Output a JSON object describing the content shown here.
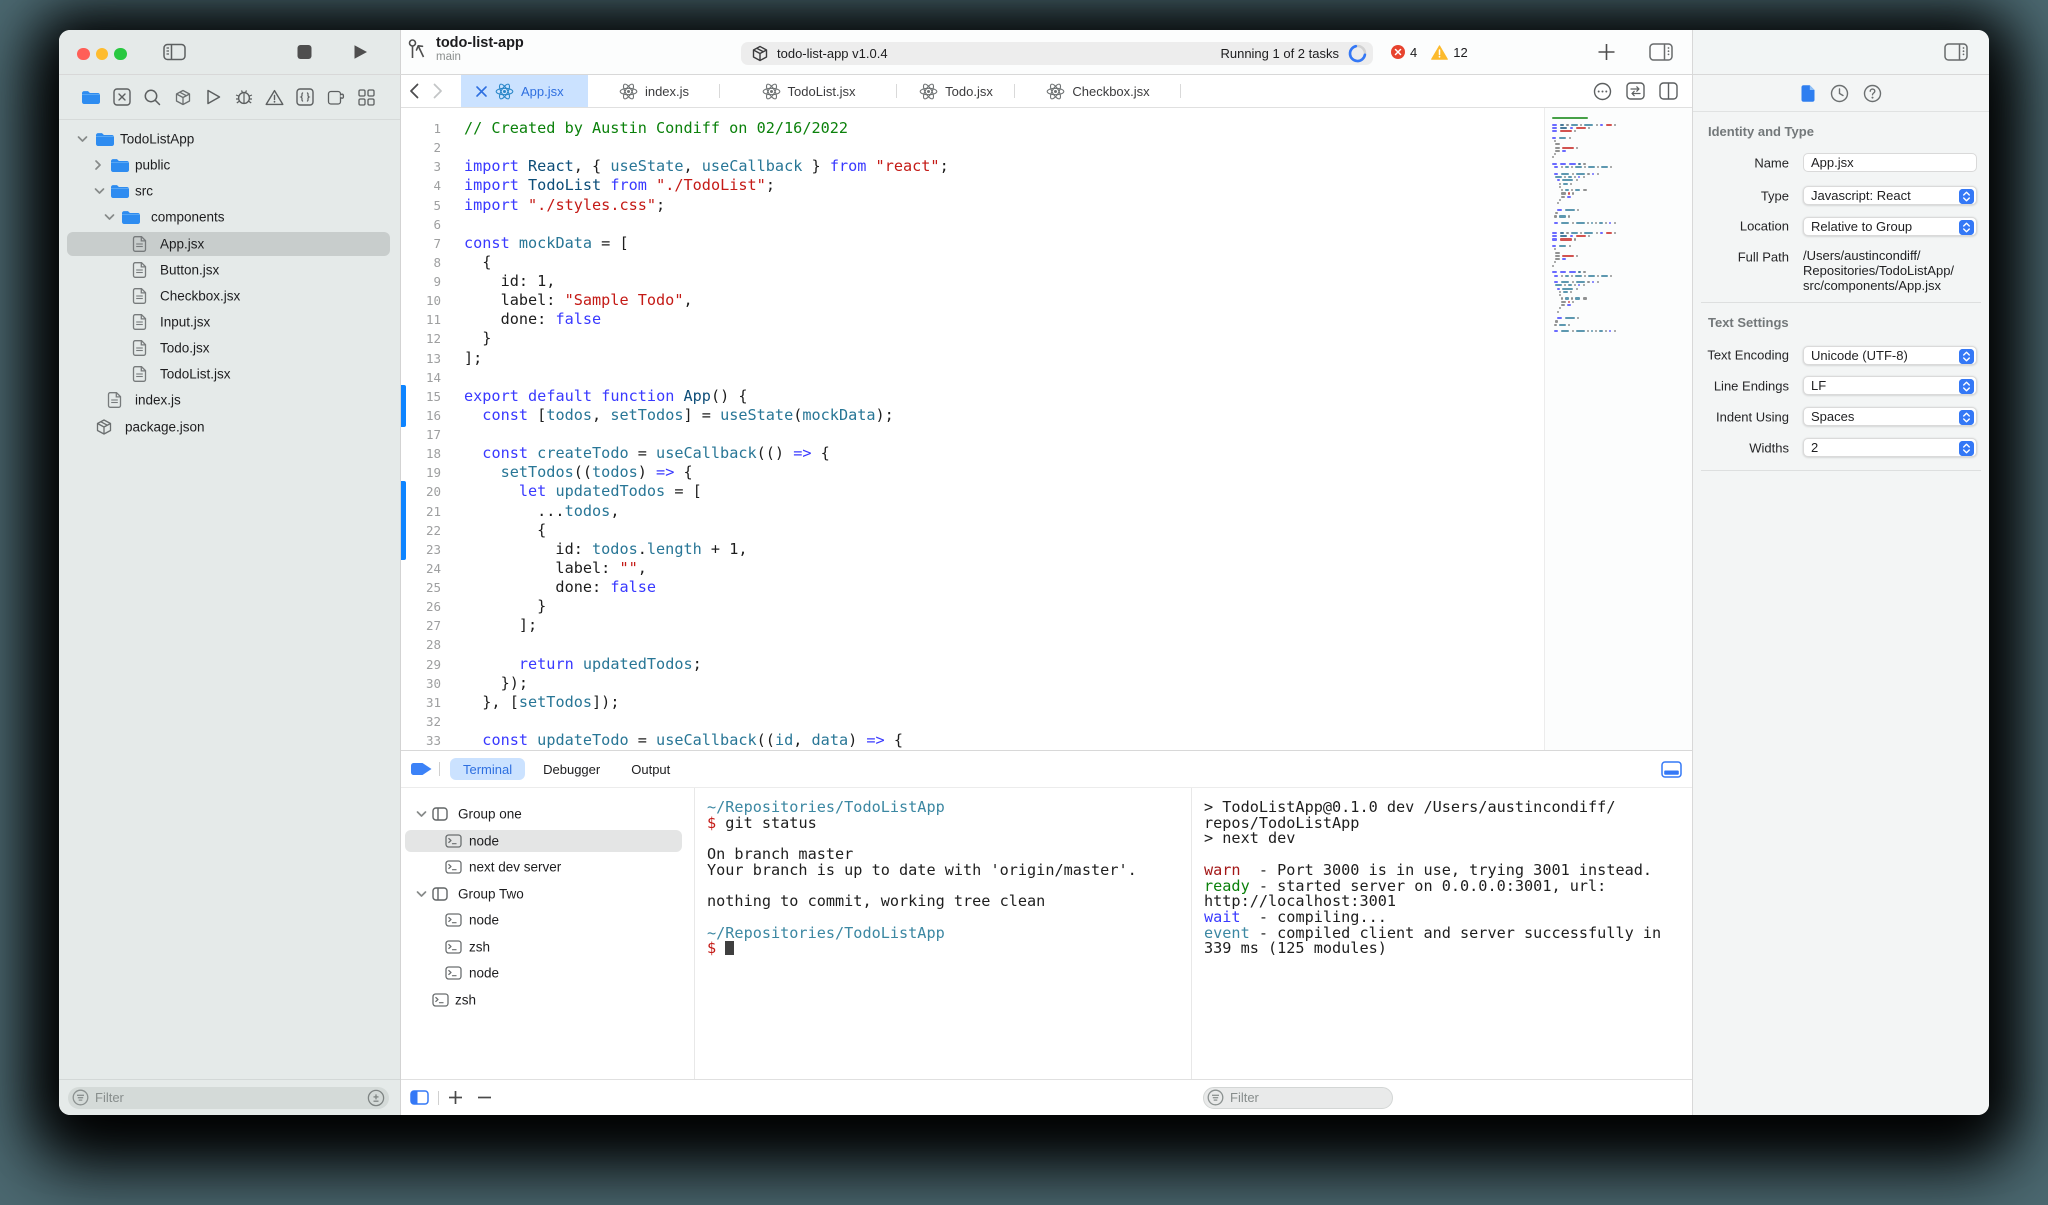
{
  "colors": {
    "accent": "#3478f6",
    "active_tab_bg": "#cbe2ff",
    "change_bar": "#0e84ff",
    "code": {
      "keyword": "#3939ff",
      "type": "#0c4d78",
      "identifier": "#287696",
      "string": "#c41a16",
      "comment": "#0b810b",
      "plain": "#1d1d1d"
    },
    "terminal": {
      "path": "#3b87a2",
      "dollar": "#c41a16",
      "warn": "#a31616",
      "ready": "#0b810b",
      "wait": "#3939ff",
      "event": "#3b87a2"
    }
  },
  "titlebar": {
    "project_name": "todo-list-app",
    "branch": "main",
    "window_controls": [
      "close",
      "minimize",
      "zoom"
    ],
    "left_icons": [
      "sidebar-toggle",
      "stop",
      "run"
    ],
    "status_pill": {
      "app_icon": "package-icon",
      "app_label": "todo-list-app v1.0.4",
      "task_status": "Running 1 of 2 tasks",
      "spinner": "progress-spinner"
    },
    "error_count": "4",
    "warning_count": "12",
    "right_icons": [
      "add",
      "panel-right-toggle"
    ],
    "inspector_icon": "panel-right-toggle"
  },
  "navigator": {
    "toolbar_icons": [
      "project-navigator",
      "xmark-square",
      "search",
      "package",
      "play-outline",
      "bug",
      "warning-triangle",
      "braces-square",
      "extension",
      "grid"
    ],
    "tree": [
      {
        "label": "TodoListApp",
        "icon": "folder",
        "chevron": "down"
      },
      {
        "label": "public",
        "icon": "folder",
        "chevron": "right"
      },
      {
        "label": "src",
        "icon": "folder",
        "chevron": "down"
      },
      {
        "label": "components",
        "icon": "folder",
        "chevron": "down"
      },
      {
        "label": "App.jsx",
        "icon": "file",
        "selected": true
      },
      {
        "label": "Button.jsx",
        "icon": "file"
      },
      {
        "label": "Checkbox.jsx",
        "icon": "file"
      },
      {
        "label": "Input.jsx",
        "icon": "file"
      },
      {
        "label": "Todo.jsx",
        "icon": "file"
      },
      {
        "label": "TodoList.jsx",
        "icon": "file"
      },
      {
        "label": "index.js",
        "icon": "file"
      },
      {
        "label": "package.json",
        "icon": "package"
      }
    ],
    "filter": {
      "placeholder": "Filter",
      "left_icon": "filter-icon",
      "right_icon": "add-filter-icon"
    }
  },
  "tabs": [
    {
      "label": "App.jsx",
      "icon": "react",
      "active": true,
      "closable": true
    },
    {
      "label": "index.js",
      "icon": "react"
    },
    {
      "label": "TodoList.jsx",
      "icon": "react"
    },
    {
      "label": "Todo.jsx",
      "icon": "react"
    },
    {
      "label": "Checkbox.jsx",
      "icon": "react"
    }
  ],
  "tabbar_right_icons": [
    "ellipsis-circle",
    "swap",
    "split-editor"
  ],
  "editor": {
    "language": "jsx",
    "change_bars": [
      {
        "from_line": 15,
        "to_line": 16
      },
      {
        "from_line": 20,
        "to_line": 23
      }
    ],
    "lines": [
      [
        [
          "c",
          "// Created by Austin Condiff on 02/16/2022"
        ]
      ],
      [],
      [
        [
          "k",
          "import"
        ],
        [
          "p",
          " "
        ],
        [
          "t",
          "React"
        ],
        [
          "p",
          ", { "
        ],
        [
          "f",
          "useState"
        ],
        [
          "p",
          ", "
        ],
        [
          "f",
          "useCallback"
        ],
        [
          "p",
          " } "
        ],
        [
          "k",
          "from"
        ],
        [
          "p",
          " "
        ],
        [
          "s",
          "\"react\""
        ],
        [
          "p",
          ";"
        ]
      ],
      [
        [
          "k",
          "import"
        ],
        [
          "p",
          " "
        ],
        [
          "t",
          "TodoList"
        ],
        [
          "p",
          " "
        ],
        [
          "k",
          "from"
        ],
        [
          "p",
          " "
        ],
        [
          "s",
          "\"./TodoList\""
        ],
        [
          "p",
          ";"
        ]
      ],
      [
        [
          "k",
          "import"
        ],
        [
          "p",
          " "
        ],
        [
          "s",
          "\"./styles.css\""
        ],
        [
          "p",
          ";"
        ]
      ],
      [],
      [
        [
          "k",
          "const"
        ],
        [
          "p",
          " "
        ],
        [
          "f",
          "mockData"
        ],
        [
          "p",
          " = ["
        ]
      ],
      [
        [
          "p",
          "  {"
        ]
      ],
      [
        [
          "p",
          "    id: 1,"
        ]
      ],
      [
        [
          "p",
          "    label: "
        ],
        [
          "s",
          "\"Sample Todo\""
        ],
        [
          "p",
          ","
        ]
      ],
      [
        [
          "p",
          "    done: "
        ],
        [
          "k",
          "false"
        ]
      ],
      [
        [
          "p",
          "  }"
        ]
      ],
      [
        [
          "p",
          "];"
        ]
      ],
      [],
      [
        [
          "k",
          "export"
        ],
        [
          "p",
          " "
        ],
        [
          "k",
          "default"
        ],
        [
          "p",
          " "
        ],
        [
          "k",
          "function"
        ],
        [
          "p",
          " "
        ],
        [
          "t",
          "App"
        ],
        [
          "p",
          "() {"
        ]
      ],
      [
        [
          "p",
          "  "
        ],
        [
          "k",
          "const"
        ],
        [
          "p",
          " ["
        ],
        [
          "f",
          "todos"
        ],
        [
          "p",
          ", "
        ],
        [
          "f",
          "setTodos"
        ],
        [
          "p",
          "] = "
        ],
        [
          "f",
          "useState"
        ],
        [
          "p",
          "("
        ],
        [
          "f",
          "mockData"
        ],
        [
          "p",
          ");"
        ]
      ],
      [],
      [
        [
          "p",
          "  "
        ],
        [
          "k",
          "const"
        ],
        [
          "p",
          " "
        ],
        [
          "f",
          "createTodo"
        ],
        [
          "p",
          " = "
        ],
        [
          "f",
          "useCallback"
        ],
        [
          "p",
          "(() "
        ],
        [
          "k",
          "=>"
        ],
        [
          "p",
          " {"
        ]
      ],
      [
        [
          "p",
          "    "
        ],
        [
          "f",
          "setTodos"
        ],
        [
          "p",
          "(("
        ],
        [
          "f",
          "todos"
        ],
        [
          "p",
          ") "
        ],
        [
          "k",
          "=>"
        ],
        [
          "p",
          " {"
        ]
      ],
      [
        [
          "p",
          "      "
        ],
        [
          "k",
          "let"
        ],
        [
          "p",
          " "
        ],
        [
          "f",
          "updatedTodos"
        ],
        [
          "p",
          " = ["
        ]
      ],
      [
        [
          "p",
          "        ..."
        ],
        [
          "f",
          "todos"
        ],
        [
          "p",
          ","
        ]
      ],
      [
        [
          "p",
          "        {"
        ]
      ],
      [
        [
          "p",
          "          id: "
        ],
        [
          "f",
          "todos"
        ],
        [
          "p",
          "."
        ],
        [
          "f",
          "length"
        ],
        [
          "p",
          " + 1,"
        ]
      ],
      [
        [
          "p",
          "          label: "
        ],
        [
          "s",
          "\"\""
        ],
        [
          "p",
          ","
        ]
      ],
      [
        [
          "p",
          "          done: "
        ],
        [
          "k",
          "false"
        ]
      ],
      [
        [
          "p",
          "        }"
        ]
      ],
      [
        [
          "p",
          "      ];"
        ]
      ],
      [],
      [
        [
          "p",
          "      "
        ],
        [
          "k",
          "return"
        ],
        [
          "p",
          " "
        ],
        [
          "f",
          "updatedTodos"
        ],
        [
          "p",
          ";"
        ]
      ],
      [
        [
          "p",
          "    });"
        ]
      ],
      [
        [
          "p",
          "  }, ["
        ],
        [
          "f",
          "setTodos"
        ],
        [
          "p",
          "]);"
        ]
      ],
      [],
      [
        [
          "p",
          "  "
        ],
        [
          "k",
          "const"
        ],
        [
          "p",
          " "
        ],
        [
          "f",
          "updateTodo"
        ],
        [
          "p",
          " = "
        ],
        [
          "f",
          "useCallback"
        ],
        [
          "p",
          "(("
        ],
        [
          "f",
          "id"
        ],
        [
          "p",
          ", "
        ],
        [
          "f",
          "data"
        ],
        [
          "p",
          ") "
        ],
        [
          "k",
          "=>"
        ],
        [
          "p",
          " {"
        ]
      ]
    ]
  },
  "bottom_panel": {
    "tabs": [
      {
        "label": "Terminal",
        "active": true
      },
      {
        "label": "Debugger"
      },
      {
        "label": "Output"
      }
    ],
    "leading_icon": "tag-blue",
    "collapse_icon": "collapse-bottom",
    "groups": [
      {
        "label": "Group one",
        "kind": "group"
      },
      {
        "label": "node",
        "kind": "item",
        "selected": true
      },
      {
        "label": "next dev server",
        "kind": "item"
      },
      {
        "label": "Group Two",
        "kind": "group"
      },
      {
        "label": "node",
        "kind": "item"
      },
      {
        "label": "zsh",
        "kind": "item"
      },
      {
        "label": "node",
        "kind": "item"
      },
      {
        "label": "zsh",
        "kind": "loose"
      }
    ],
    "terminal1": [
      [
        [
          "path",
          "~/Repositories/TodoListApp"
        ]
      ],
      [
        [
          "dollar",
          "$ "
        ],
        [
          "p",
          "git status"
        ]
      ],
      [],
      [
        [
          "p",
          "On branch master"
        ]
      ],
      [
        [
          "p",
          "Your branch is up to date with 'origin/master'."
        ]
      ],
      [],
      [
        [
          "p",
          "nothing to commit, working tree clean"
        ]
      ],
      [],
      [
        [
          "path",
          "~/Repositories/TodoListApp"
        ]
      ],
      [
        [
          "dollar",
          "$ "
        ],
        [
          "cursor",
          ""
        ]
      ]
    ],
    "terminal2": [
      [
        [
          "p",
          "> TodoListApp@0.1.0 dev /Users/austincondiff/"
        ]
      ],
      [
        [
          "p",
          "repos/TodoListApp"
        ]
      ],
      [
        [
          "p",
          "> next dev"
        ]
      ],
      [],
      [
        [
          "warn",
          "warn"
        ],
        [
          "p",
          "  - Port 3000 is in use, trying 3001 instead."
        ]
      ],
      [
        [
          "ready",
          "ready"
        ],
        [
          "p",
          " - started server on 0.0.0.0:3001, url:"
        ]
      ],
      [
        [
          "p",
          "http://localhost:3001"
        ]
      ],
      [
        [
          "wait",
          "wait"
        ],
        [
          "p",
          "  - compiling..."
        ]
      ],
      [
        [
          "event",
          "event"
        ],
        [
          "p",
          " - compiled client and server successfully in"
        ]
      ],
      [
        [
          "p",
          "339 ms (125 modules)"
        ]
      ]
    ],
    "bottom_icons": [
      "sidebar-blue",
      "plus",
      "minus"
    ],
    "filter": {
      "placeholder": "Filter",
      "left_icon": "filter-icon"
    }
  },
  "inspector": {
    "tab_icons": [
      "file-inspector",
      "history-inspector",
      "help-inspector"
    ],
    "sections": [
      {
        "header": "Identity and Type",
        "rows": [
          {
            "label": "Name",
            "kind": "input",
            "value": "App.jsx"
          },
          {
            "label": "Type",
            "kind": "popup",
            "value": "Javascript: React"
          },
          {
            "label": "Location",
            "kind": "popup",
            "value": "Relative to Group"
          },
          {
            "label": "Full Path",
            "kind": "text",
            "value": "/Users/austincondiff/\nRepositories/TodoListApp/\nsrc/components/App.jsx"
          }
        ]
      },
      {
        "header": "Text Settings",
        "rows": [
          {
            "label": "Text Encoding",
            "kind": "popup",
            "value": "Unicode (UTF-8)"
          },
          {
            "label": "Line Endings",
            "kind": "popup",
            "value": "LF"
          },
          {
            "label": "Indent Using",
            "kind": "popup",
            "value": "Spaces"
          },
          {
            "label": "Widths",
            "kind": "popup",
            "value": "2"
          }
        ]
      }
    ]
  }
}
